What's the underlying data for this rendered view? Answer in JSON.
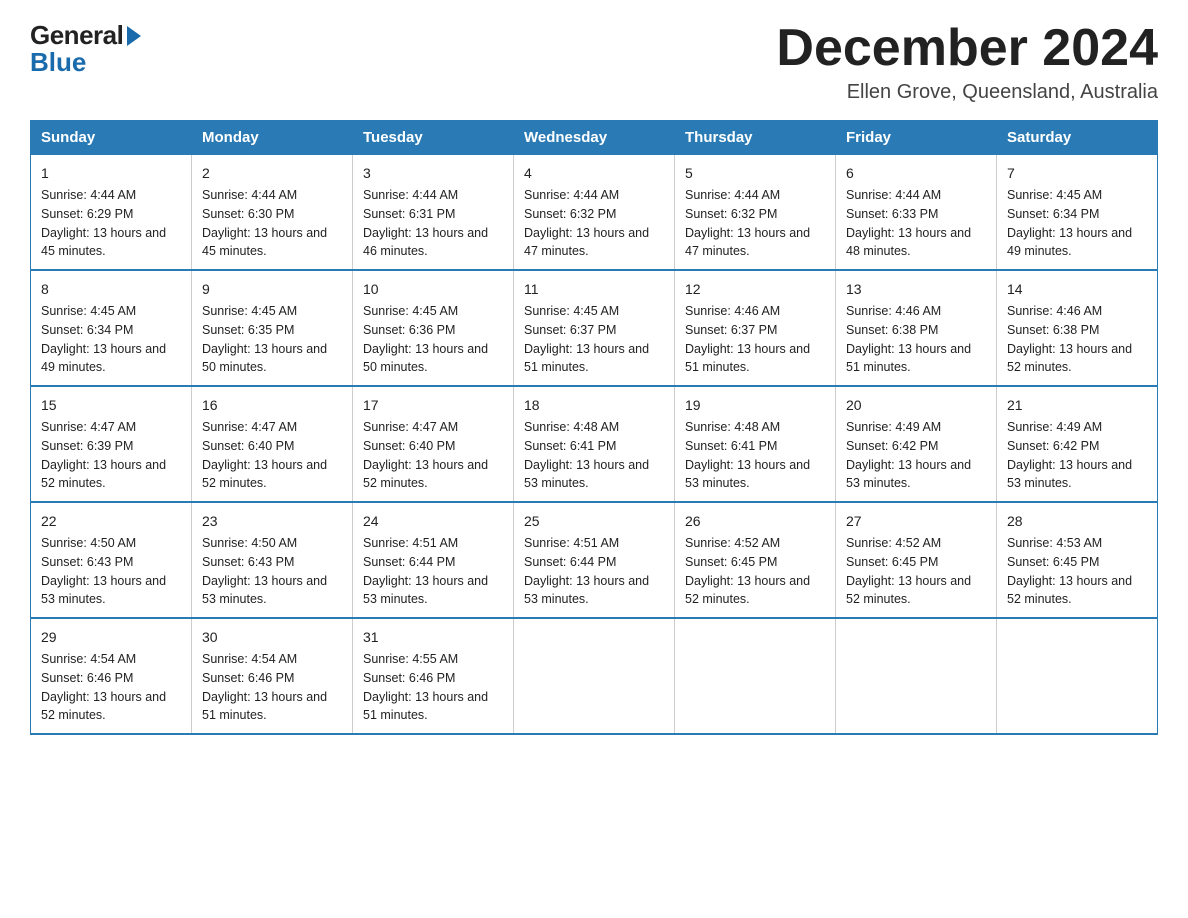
{
  "logo": {
    "general": "General",
    "blue": "Blue"
  },
  "title": "December 2024",
  "location": "Ellen Grove, Queensland, Australia",
  "days_header": [
    "Sunday",
    "Monday",
    "Tuesday",
    "Wednesday",
    "Thursday",
    "Friday",
    "Saturday"
  ],
  "weeks": [
    [
      {
        "num": "1",
        "sunrise": "4:44 AM",
        "sunset": "6:29 PM",
        "daylight": "13 hours and 45 minutes."
      },
      {
        "num": "2",
        "sunrise": "4:44 AM",
        "sunset": "6:30 PM",
        "daylight": "13 hours and 45 minutes."
      },
      {
        "num": "3",
        "sunrise": "4:44 AM",
        "sunset": "6:31 PM",
        "daylight": "13 hours and 46 minutes."
      },
      {
        "num": "4",
        "sunrise": "4:44 AM",
        "sunset": "6:32 PM",
        "daylight": "13 hours and 47 minutes."
      },
      {
        "num": "5",
        "sunrise": "4:44 AM",
        "sunset": "6:32 PM",
        "daylight": "13 hours and 47 minutes."
      },
      {
        "num": "6",
        "sunrise": "4:44 AM",
        "sunset": "6:33 PM",
        "daylight": "13 hours and 48 minutes."
      },
      {
        "num": "7",
        "sunrise": "4:45 AM",
        "sunset": "6:34 PM",
        "daylight": "13 hours and 49 minutes."
      }
    ],
    [
      {
        "num": "8",
        "sunrise": "4:45 AM",
        "sunset": "6:34 PM",
        "daylight": "13 hours and 49 minutes."
      },
      {
        "num": "9",
        "sunrise": "4:45 AM",
        "sunset": "6:35 PM",
        "daylight": "13 hours and 50 minutes."
      },
      {
        "num": "10",
        "sunrise": "4:45 AM",
        "sunset": "6:36 PM",
        "daylight": "13 hours and 50 minutes."
      },
      {
        "num": "11",
        "sunrise": "4:45 AM",
        "sunset": "6:37 PM",
        "daylight": "13 hours and 51 minutes."
      },
      {
        "num": "12",
        "sunrise": "4:46 AM",
        "sunset": "6:37 PM",
        "daylight": "13 hours and 51 minutes."
      },
      {
        "num": "13",
        "sunrise": "4:46 AM",
        "sunset": "6:38 PM",
        "daylight": "13 hours and 51 minutes."
      },
      {
        "num": "14",
        "sunrise": "4:46 AM",
        "sunset": "6:38 PM",
        "daylight": "13 hours and 52 minutes."
      }
    ],
    [
      {
        "num": "15",
        "sunrise": "4:47 AM",
        "sunset": "6:39 PM",
        "daylight": "13 hours and 52 minutes."
      },
      {
        "num": "16",
        "sunrise": "4:47 AM",
        "sunset": "6:40 PM",
        "daylight": "13 hours and 52 minutes."
      },
      {
        "num": "17",
        "sunrise": "4:47 AM",
        "sunset": "6:40 PM",
        "daylight": "13 hours and 52 minutes."
      },
      {
        "num": "18",
        "sunrise": "4:48 AM",
        "sunset": "6:41 PM",
        "daylight": "13 hours and 53 minutes."
      },
      {
        "num": "19",
        "sunrise": "4:48 AM",
        "sunset": "6:41 PM",
        "daylight": "13 hours and 53 minutes."
      },
      {
        "num": "20",
        "sunrise": "4:49 AM",
        "sunset": "6:42 PM",
        "daylight": "13 hours and 53 minutes."
      },
      {
        "num": "21",
        "sunrise": "4:49 AM",
        "sunset": "6:42 PM",
        "daylight": "13 hours and 53 minutes."
      }
    ],
    [
      {
        "num": "22",
        "sunrise": "4:50 AM",
        "sunset": "6:43 PM",
        "daylight": "13 hours and 53 minutes."
      },
      {
        "num": "23",
        "sunrise": "4:50 AM",
        "sunset": "6:43 PM",
        "daylight": "13 hours and 53 minutes."
      },
      {
        "num": "24",
        "sunrise": "4:51 AM",
        "sunset": "6:44 PM",
        "daylight": "13 hours and 53 minutes."
      },
      {
        "num": "25",
        "sunrise": "4:51 AM",
        "sunset": "6:44 PM",
        "daylight": "13 hours and 53 minutes."
      },
      {
        "num": "26",
        "sunrise": "4:52 AM",
        "sunset": "6:45 PM",
        "daylight": "13 hours and 52 minutes."
      },
      {
        "num": "27",
        "sunrise": "4:52 AM",
        "sunset": "6:45 PM",
        "daylight": "13 hours and 52 minutes."
      },
      {
        "num": "28",
        "sunrise": "4:53 AM",
        "sunset": "6:45 PM",
        "daylight": "13 hours and 52 minutes."
      }
    ],
    [
      {
        "num": "29",
        "sunrise": "4:54 AM",
        "sunset": "6:46 PM",
        "daylight": "13 hours and 52 minutes."
      },
      {
        "num": "30",
        "sunrise": "4:54 AM",
        "sunset": "6:46 PM",
        "daylight": "13 hours and 51 minutes."
      },
      {
        "num": "31",
        "sunrise": "4:55 AM",
        "sunset": "6:46 PM",
        "daylight": "13 hours and 51 minutes."
      },
      null,
      null,
      null,
      null
    ]
  ]
}
